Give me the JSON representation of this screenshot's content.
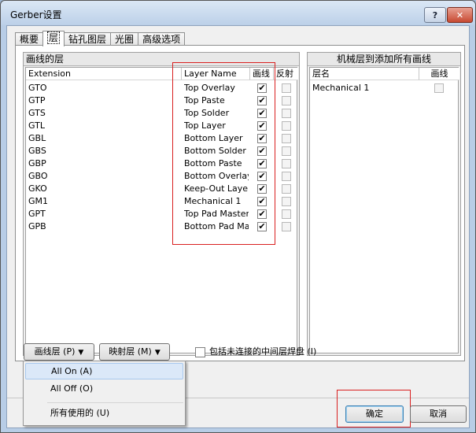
{
  "window": {
    "title": "Gerber设置",
    "help_label": "?",
    "close_label": "✕"
  },
  "tabs": [
    {
      "label": "概要"
    },
    {
      "label": "层"
    },
    {
      "label": "钻孔图层"
    },
    {
      "label": "光圈"
    },
    {
      "label": "高级选项"
    }
  ],
  "plot_layers": {
    "title": "画线的层",
    "headers": {
      "extension": "Extension",
      "layer_name": "Layer Name",
      "plot": "画线",
      "mirror": "反射"
    },
    "rows": [
      {
        "ext": "GTO",
        "name": "Top Overlay",
        "plot": true,
        "mirror": false
      },
      {
        "ext": "GTP",
        "name": "Top Paste",
        "plot": true,
        "mirror": false
      },
      {
        "ext": "GTS",
        "name": "Top Solder",
        "plot": true,
        "mirror": false
      },
      {
        "ext": "GTL",
        "name": "Top Layer",
        "plot": true,
        "mirror": false
      },
      {
        "ext": "GBL",
        "name": "Bottom Layer",
        "plot": true,
        "mirror": false
      },
      {
        "ext": "GBS",
        "name": "Bottom Solder",
        "plot": true,
        "mirror": false
      },
      {
        "ext": "GBP",
        "name": "Bottom Paste",
        "plot": true,
        "mirror": false
      },
      {
        "ext": "GBO",
        "name": "Bottom Overlay",
        "plot": true,
        "mirror": false
      },
      {
        "ext": "GKO",
        "name": "Keep-Out Layer",
        "plot": true,
        "mirror": false
      },
      {
        "ext": "GM1",
        "name": "Mechanical 1",
        "plot": true,
        "mirror": false
      },
      {
        "ext": "GPT",
        "name": "Top Pad Master",
        "plot": true,
        "mirror": false
      },
      {
        "ext": "GPB",
        "name": "Bottom Pad Master",
        "plot": true,
        "mirror": false
      }
    ]
  },
  "mech_layers": {
    "title": "机械层到添加所有画线",
    "headers": {
      "layer_name": "层名",
      "plot": "画线"
    },
    "rows": [
      {
        "name": "Mechanical 1",
        "plot": false
      }
    ]
  },
  "buttons": {
    "plot_layers": "画线层 (P)",
    "map_layers": "映射层 (M)",
    "ok": "确定",
    "cancel": "取消",
    "dropdown_arrow": "▼"
  },
  "include_unconnected": {
    "label": "包括未连接的中间层焊盘 (I)",
    "checked": false
  },
  "menu": {
    "items": [
      {
        "label": "All On (A)"
      },
      {
        "label": "All Off (O)"
      },
      {
        "label": "所有使用的 (U)"
      }
    ]
  },
  "checkmark": "✔"
}
